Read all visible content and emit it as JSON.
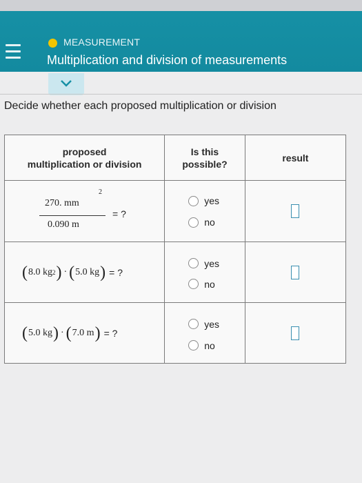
{
  "header": {
    "topic": "MEASUREMENT",
    "title": "Multiplication and division of measurements"
  },
  "instruction": "Decide whether each proposed multiplication or division",
  "table": {
    "headers": {
      "col1_line1": "proposed",
      "col1_line2": "multiplication or division",
      "col2_line1": "Is this",
      "col2_line2": "possible?",
      "col3": "result"
    },
    "rows": [
      {
        "numerator": "270. mm",
        "numerator_exp": "2",
        "denominator": "0.090 m",
        "equals": "= ?",
        "option_yes": "yes",
        "option_no": "no"
      },
      {
        "factor1": "8.0 kg",
        "factor1_exp": "2",
        "dot": "·",
        "factor2": "5.0 kg",
        "equals": "= ?",
        "option_yes": "yes",
        "option_no": "no"
      },
      {
        "factor1": "5.0 kg",
        "dot": "·",
        "factor2": "7.0 m",
        "equals": "= ?",
        "option_yes": "yes",
        "option_no": "no"
      }
    ]
  },
  "colors": {
    "header_teal": "#138a9f",
    "topic_dot": "#f1c500",
    "result_box_border": "#3a8fb0"
  }
}
